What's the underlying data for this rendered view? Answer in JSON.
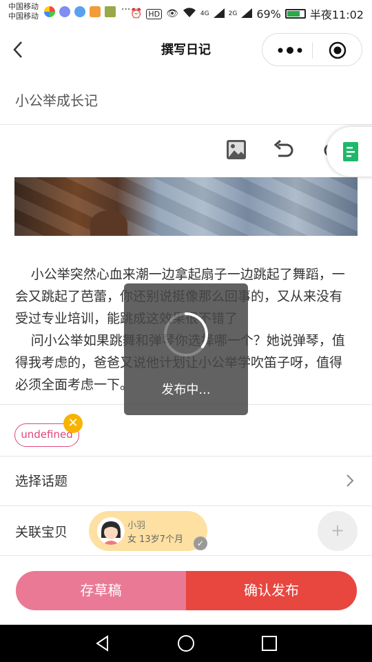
{
  "status_bar": {
    "carrier_1": "中国移动",
    "carrier_2": "中国移动",
    "more": "···",
    "network_4g": "4G",
    "network_2g": "2G",
    "battery": "69%",
    "time": "半夜11:02"
  },
  "nav": {
    "title": "撰写日记"
  },
  "diary": {
    "title": "小公举成长记",
    "paragraph_1": "小公举突然心血来潮一边拿起扇子一边跳起了舞蹈，一会又跳起了芭蕾，你还别说挺像那么回事的，又从来没有受过专业培训，能跳成这效果很不错了",
    "paragraph_2": "问小公举如果跳舞和弹琴你选择哪一个？她说弹琴，值得我考虑的，爸爸又说他计划让小公举学吹笛子呀，值得必须全面考虑一下。"
  },
  "tag": {
    "label": "undefined",
    "remove": "✕"
  },
  "topic": {
    "label": "选择话题"
  },
  "baby": {
    "label": "关联宝贝",
    "name": "小羽",
    "info": "女  13岁7个月",
    "check": "✓",
    "add": "+"
  },
  "buttons": {
    "draft": "存草稿",
    "publish": "确认发布"
  },
  "toast": {
    "text": "发布中..."
  },
  "colors": {
    "accent_pink": "#e0457b",
    "draft_button": "#ea7995",
    "publish_button": "#e7473f",
    "baby_card": "#fde0a2"
  }
}
